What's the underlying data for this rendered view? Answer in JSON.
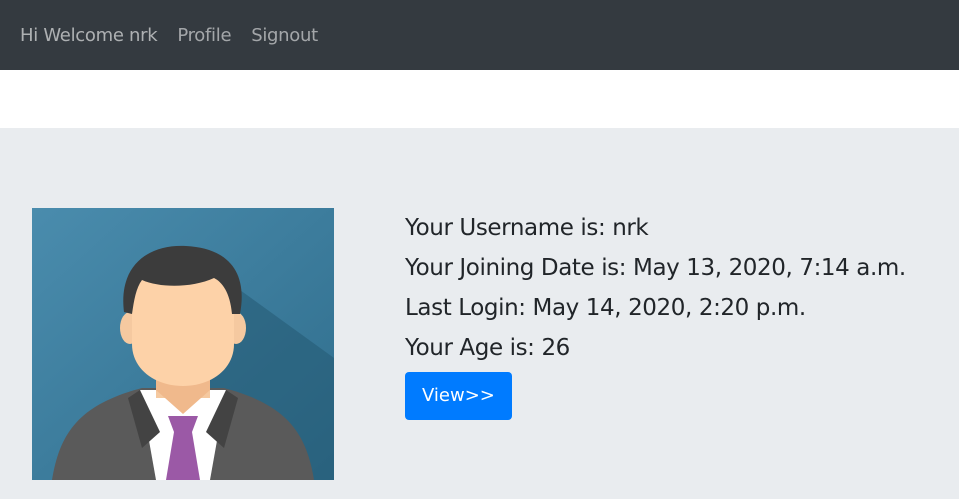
{
  "navbar": {
    "welcome": "Hi Welcome nrk",
    "profile": "Profile",
    "signout": "Signout",
    "background_color": "#343a40"
  },
  "profile": {
    "avatar_icon": "businessman-avatar-icon",
    "username_line": "Your Username is: nrk",
    "joining_date_line": "Your Joining Date is: May 13, 2020, 7:14 a.m.",
    "last_login_line": "Last Login: May 14, 2020, 2:20 p.m.",
    "age_line": "Your Age is: 26",
    "view_button_label": "View>>",
    "button_color": "#007bff",
    "panel_color": "#e9ecef"
  }
}
